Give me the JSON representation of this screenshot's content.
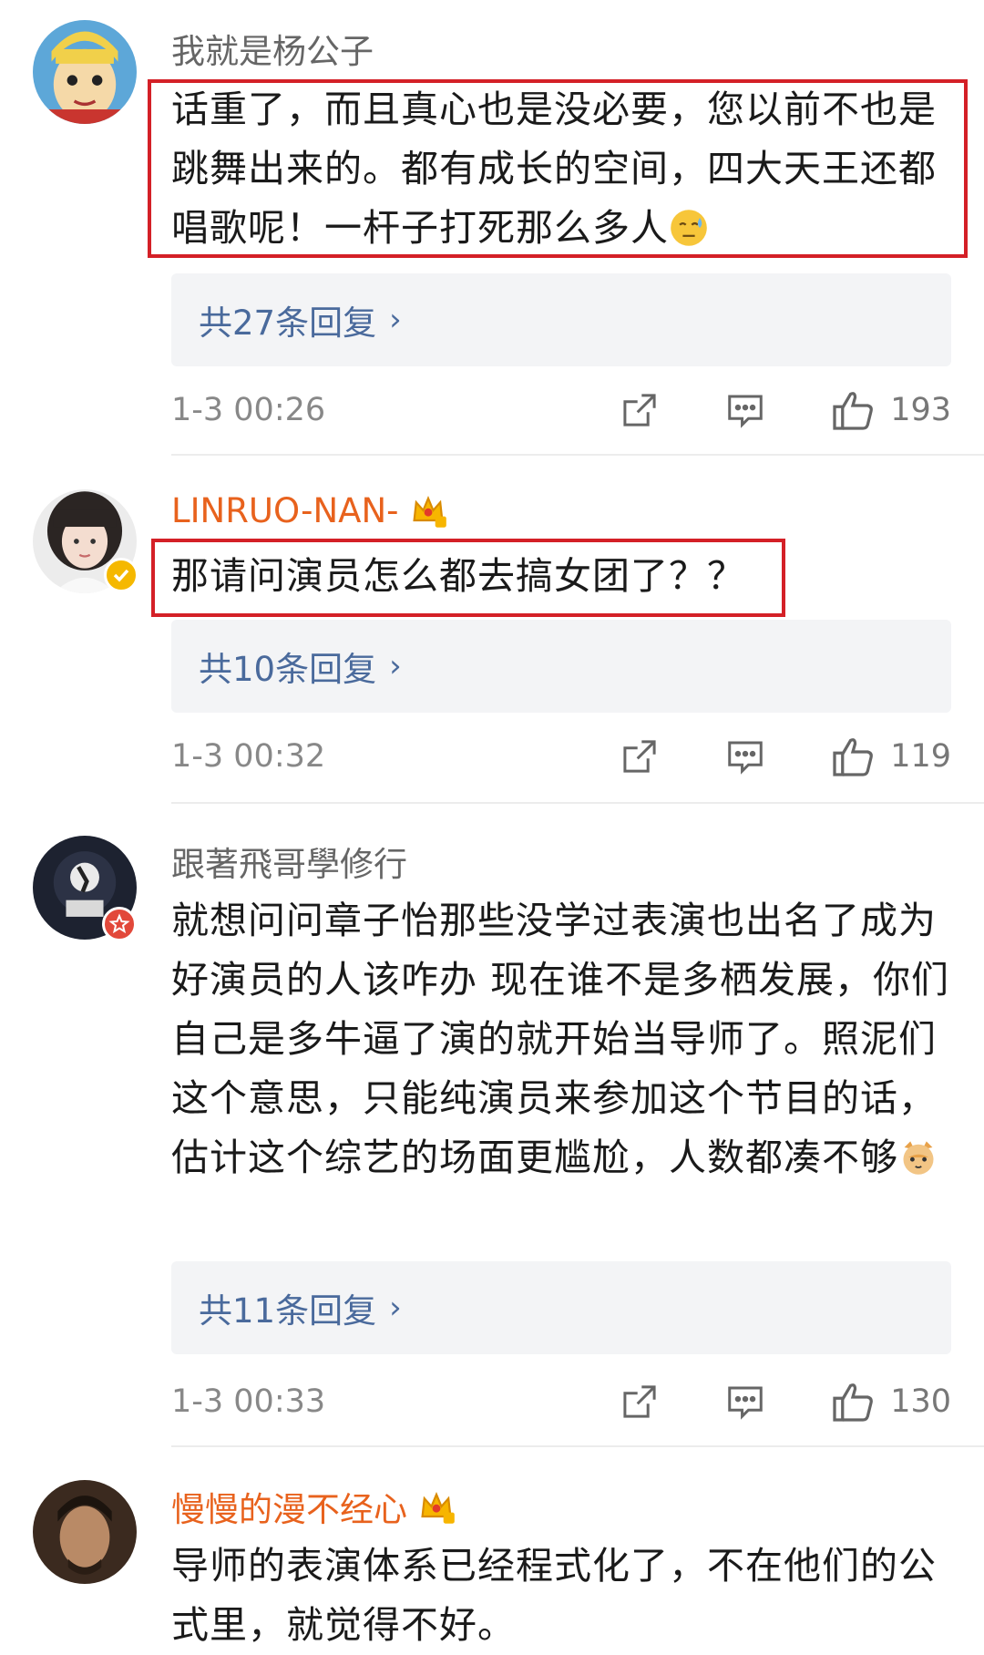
{
  "comments": [
    {
      "username": "我就是杨公子",
      "text": "话重了，而且真心也是没必要，您以前不也是跳舞出来的。都有成长的空间，四大天王还都唱歌呢！一杆子打死那么多人",
      "replies": "共27条回复",
      "time": "1-3 00:26",
      "likes": "193"
    },
    {
      "username": "LINRUO-NAN-",
      "text": "那请问演员怎么都去搞女团了？？",
      "replies": "共10条回复",
      "time": "1-3 00:32",
      "likes": "119"
    },
    {
      "username": "跟著飛哥學修行",
      "text": "就想问问章子怡那些没学过表演也出名了成为好演员的人该咋办 现在谁不是多栖发展，你们自己是多牛逼了演的就开始当导师了。照泥们这个意思，只能纯演员来参加这个节目的话，估计这个综艺的场面更尴尬，人数都凑不够",
      "replies": "共11条回复",
      "time": "1-3 00:33",
      "likes": "130"
    },
    {
      "username": "慢慢的漫不经心",
      "text": "导师的表演体系已经程式化了，不在他们的公式里，就觉得不好。"
    }
  ],
  "colors": {
    "highlight": "#d42027",
    "reply_link": "#4a6a9c",
    "vip_name": "#e8621d"
  },
  "icons": [
    "share-icon",
    "comment-icon",
    "like-icon",
    "crown-badge-icon",
    "verified-badge-icon",
    "sweat-emoji",
    "cat-emoji"
  ]
}
